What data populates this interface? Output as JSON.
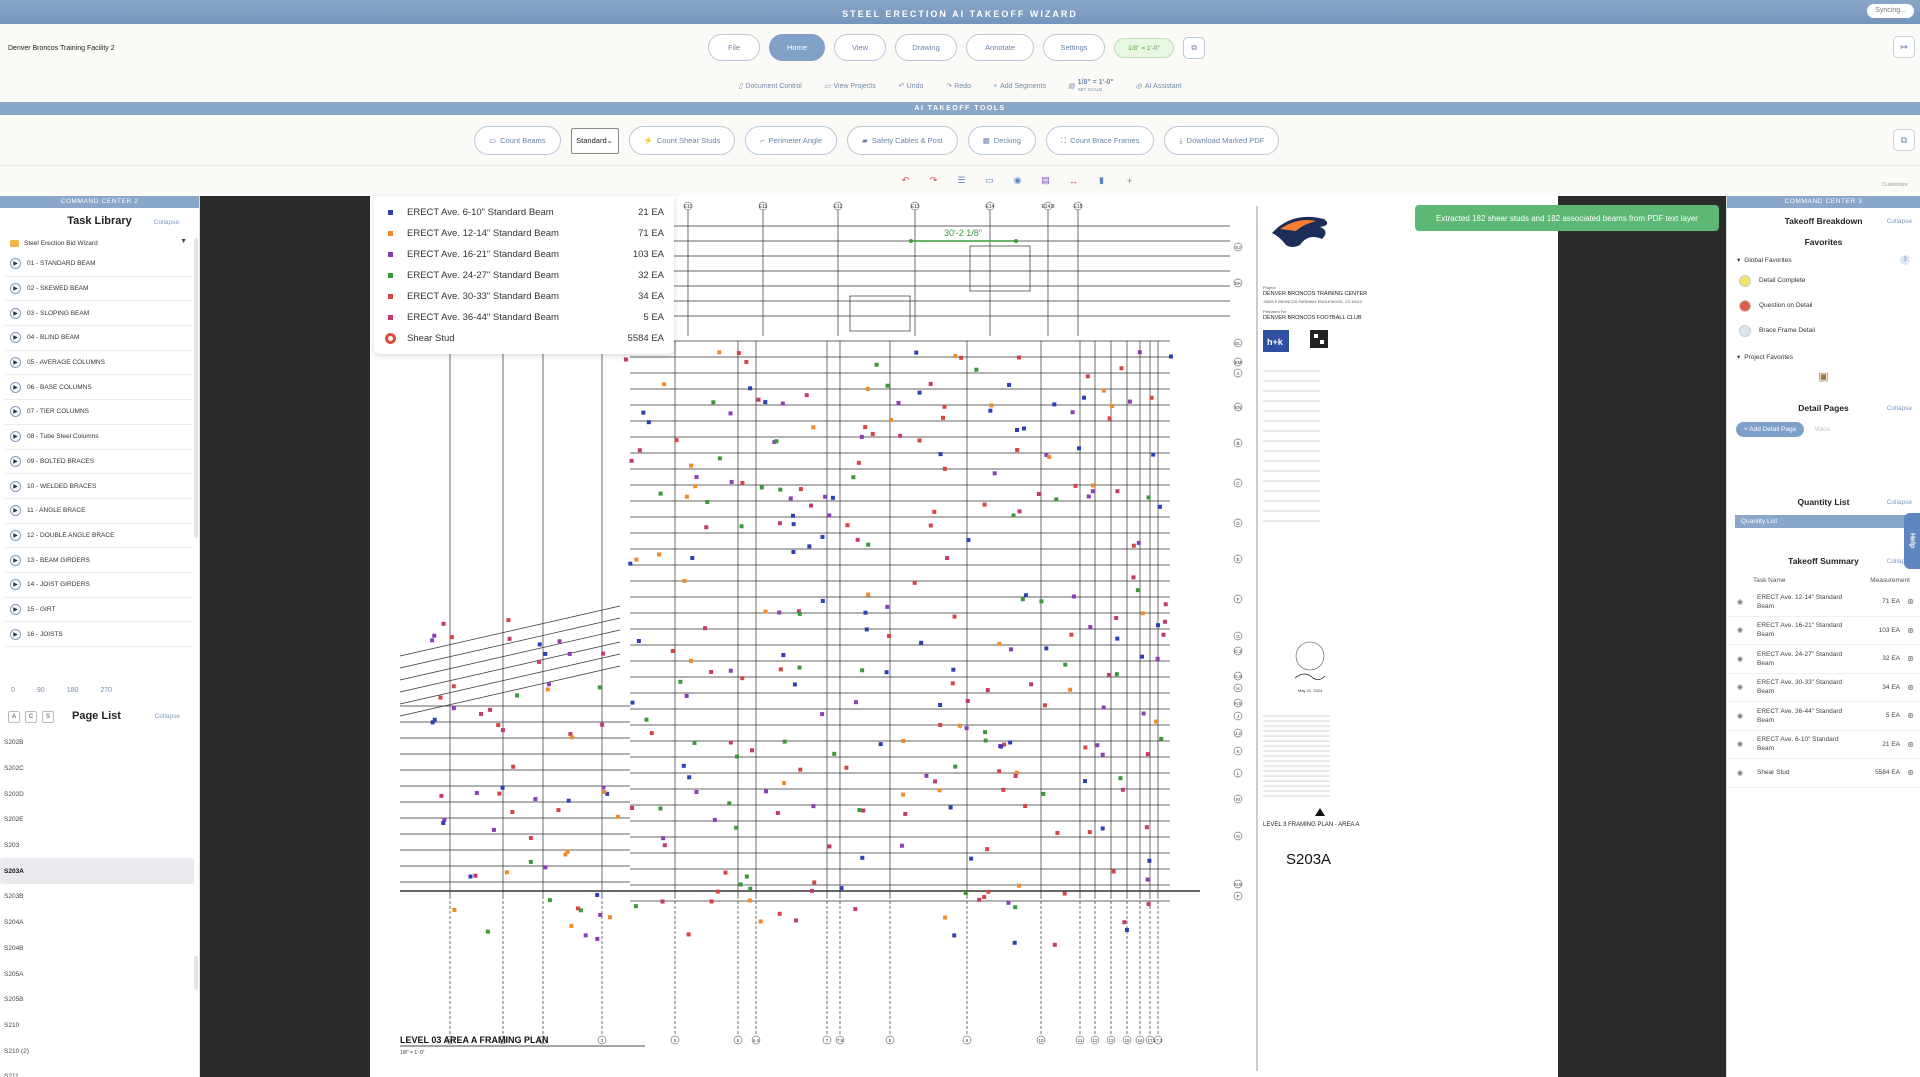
{
  "app": {
    "title": "STEEL ERECTION AI TAKEOFF WIZARD",
    "sync_status": "Syncing...",
    "project_name": "Denver Broncos Training Facility 2"
  },
  "nav": {
    "tabs": [
      {
        "label": "File",
        "w": 52
      },
      {
        "label": "Home",
        "w": 56
      },
      {
        "label": "View",
        "w": 52
      },
      {
        "label": "Drawing",
        "w": 62
      },
      {
        "label": "Annotate",
        "w": 68
      },
      {
        "label": "Settings",
        "w": 62
      }
    ],
    "scale_pill": "1/8\" = 1'-0\""
  },
  "subbar": {
    "document_control": "Document Control",
    "view_projects": "View Projects",
    "undo": "Undo",
    "redo": "Redo",
    "add_segments": "Add Segments",
    "scale": "1/8\" = 1'-0\"",
    "scale_sub": "SET SCALE",
    "ai_assistant": "AI Assistant"
  },
  "ai_tools": {
    "band": "AI TAKEOFF TOOLS",
    "count_beams": "Count Beams",
    "standard_select": "Standard",
    "count_shear_studs": "Count Shear Studs",
    "perimeter_angle": "Perimeter Angle",
    "safety_cables": "Safety Cables & Post",
    "decking": "Decking",
    "count_brace_frames": "Count Brace Frames",
    "download_pdf": "Download Marked PDF",
    "customize": "Customize"
  },
  "left_panel": {
    "band": "COMMAND CENTER 2",
    "title": "Task Library",
    "collapse": "Collapse",
    "wizard_label": "Steel Erection Bid Wizard",
    "tasks": [
      "01 - STANDARD BEAM",
      "02 - SKEWED BEAM",
      "03 - SLOPING BEAM",
      "04 - BLIND BEAM",
      "05 - AVERAGE COLUMNS",
      "06 - BASE COLUMNS",
      "07 - TIER COLUMNS",
      "08 - Tube Steel Columns",
      "09 - BOLTED BRACES",
      "10 - WELDED BRACES",
      "11 - ANGLE BRACE",
      "12 - DOUBLE ANGLE BRACE",
      "13 - BEAM GIRDERS",
      "14 - JOIST GIRDERS",
      "15 - GIRT",
      "16 - JOISTS"
    ],
    "rotations": [
      "0",
      "90",
      "180",
      "270"
    ],
    "page_letters": [
      "A",
      "C",
      "S"
    ],
    "page_list_title": "Page List",
    "page_list_collapse": "Collapse",
    "pages": [
      "S202B",
      "S202C",
      "S202D",
      "S202E",
      "S203",
      "S203A",
      "S203B",
      "S204A",
      "S204B",
      "S205A",
      "S205B",
      "S210",
      "S210 (2)",
      "S211"
    ],
    "selected_page": "S203A"
  },
  "legend": {
    "rows": [
      {
        "label": "ERECT Ave. 6-10\" Standard Beam",
        "value": "21 EA",
        "color": "#2f3fb5"
      },
      {
        "label": "ERECT Ave. 12-14\" Standard Beam",
        "value": "71 EA",
        "color": "#f08a2a"
      },
      {
        "label": "ERECT Ave. 16-21\" Standard Beam",
        "value": "103 EA",
        "color": "#8b3fb5"
      },
      {
        "label": "ERECT Ave. 24-27\" Standard Beam",
        "value": "32 EA",
        "color": "#3a9a3a"
      },
      {
        "label": "ERECT Ave. 30-33\" Standard Beam",
        "value": "34 EA",
        "color": "#d64545"
      },
      {
        "label": "ERECT Ave. 36-44\" Standard Beam",
        "value": "5 EA",
        "color": "#c23b6a"
      }
    ],
    "stud": {
      "label": "Shear Stud",
      "value": "5584 EA"
    }
  },
  "toast": "Extracted 182 shear studs and 182 associated beams from PDF text layer",
  "drawing": {
    "dimension": "30'-2 1/8\"",
    "grid_top": [
      "E10",
      "E11",
      "E12",
      "E13",
      "E14",
      "E14.8",
      "E15"
    ],
    "grid_right": [
      "EJ",
      "EK",
      "EL",
      "EM",
      "A",
      "EN",
      "B",
      "C",
      "D",
      "E",
      "F",
      "G",
      "G.2",
      "G.8",
      "H",
      "H.5",
      "J",
      "J.2",
      "K",
      "L",
      "M",
      "N",
      "N.8",
      "P"
    ],
    "grid_bottom": [
      "1",
      "1.8",
      "2",
      "3",
      "5",
      "6",
      "6.4",
      "7",
      "7.8",
      "8",
      "9",
      "10",
      "11",
      "12",
      "13",
      "15",
      "16",
      "17",
      "17.2"
    ],
    "plan_title": "LEVEL 03 AREA A FRAMING PLAN",
    "plan_scale": "1/8\" = 1'-0\"",
    "tb_project_label": "Project",
    "tb_project": "DENVER BRONCOS TRAINING CENTER",
    "tb_address": "13655 E BRONCOS PARKWAY ENGLEWOOD, CO 80112",
    "tb_prepared_label": "Prepared For",
    "tb_client": "DENVER BRONCOS FOOTBALL CLUB",
    "tb_firm_logo": "h+k",
    "tb_sheet_title": "LEVEL 3 FRAMING PLAN - AREA A",
    "tb_sheet_no": "S203A",
    "tb_date": "May 22, 2024"
  },
  "right_panel": {
    "band": "COMMAND CENTER 3",
    "takeoff_breakdown": "Takeoff Breakdown",
    "collapse": "Collapse",
    "favorites": "Favorites",
    "global_favorites": "Global Favorites",
    "global_count": "3",
    "fav_items": [
      {
        "label": "Detail Complete",
        "color": "#f5e26a"
      },
      {
        "label": "Question on Detail",
        "color": "#e05a4a"
      },
      {
        "label": "Brace Frame Detail",
        "color": "#d8e6f3"
      }
    ],
    "project_favorites": "Project Favorites",
    "detail_pages": "Detail Pages",
    "add_detail_page": "+ Add Detail Page",
    "voice": "Voice",
    "quantity_list": "Quantity List",
    "quantity_list_bar": "Quantity List",
    "takeoff_summary": "Takeoff Summary",
    "col_task": "Task Name",
    "col_measure": "Measurement",
    "summary": [
      {
        "name": "ERECT Ave. 12-14\" Standard Beam",
        "value": "71 EA"
      },
      {
        "name": "ERECT Ave. 16-21\" Standard Beam",
        "value": "103 EA"
      },
      {
        "name": "ERECT Ave. 24-27\" Standard Beam",
        "value": "32 EA"
      },
      {
        "name": "ERECT Ave. 30-33\" Standard Beam",
        "value": "34 EA"
      },
      {
        "name": "ERECT Ave. 36-44\" Standard Beam",
        "value": "5 EA"
      },
      {
        "name": "ERECT Ave. 6-10\" Standard Beam",
        "value": "21 EA"
      },
      {
        "name": "Shear Stud",
        "value": "5584 EA"
      }
    ],
    "help": "Help"
  }
}
